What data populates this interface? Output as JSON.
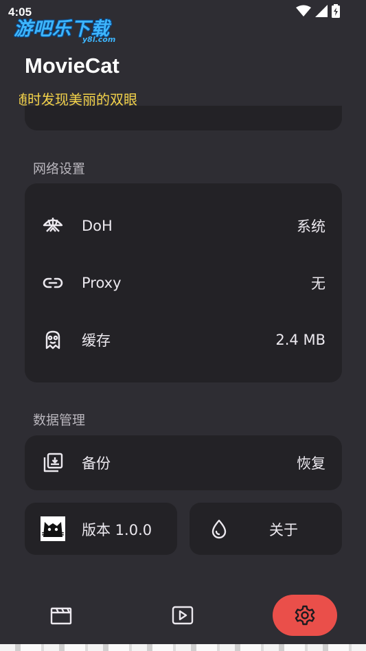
{
  "status_bar": {
    "time": "4:05",
    "icons": [
      "wifi-icon",
      "signal-icon",
      "battery-icon"
    ]
  },
  "watermark": {
    "text": "游吧乐下载",
    "sub": "y8l.com"
  },
  "app": {
    "title": "MovieCat",
    "subtitle": "随时发现美丽的双眼"
  },
  "network": {
    "heading": "网络设置",
    "items": [
      {
        "icon": "umbrella-icon",
        "label": "DoH",
        "value": "系统"
      },
      {
        "icon": "link-icon",
        "label": "Proxy",
        "value": "无"
      },
      {
        "icon": "cache-icon",
        "label": "缓存",
        "value": "2.4 MB"
      }
    ]
  },
  "data_mgmt": {
    "heading": "数据管理",
    "backup_label": "备份",
    "restore_label": "恢复",
    "version_label": "版本 1.0.0",
    "about_label": "关于"
  },
  "nav": {
    "items": [
      {
        "icon": "movie-clapper-icon",
        "active": false
      },
      {
        "icon": "play-icon",
        "active": false
      },
      {
        "icon": "gear-icon",
        "active": true
      }
    ]
  },
  "colors": {
    "background": "#2e2d33",
    "card": "#232226",
    "accent": "#ea4f4a",
    "subtitle": "#f3d24a",
    "watermark": "#3db6ff"
  }
}
